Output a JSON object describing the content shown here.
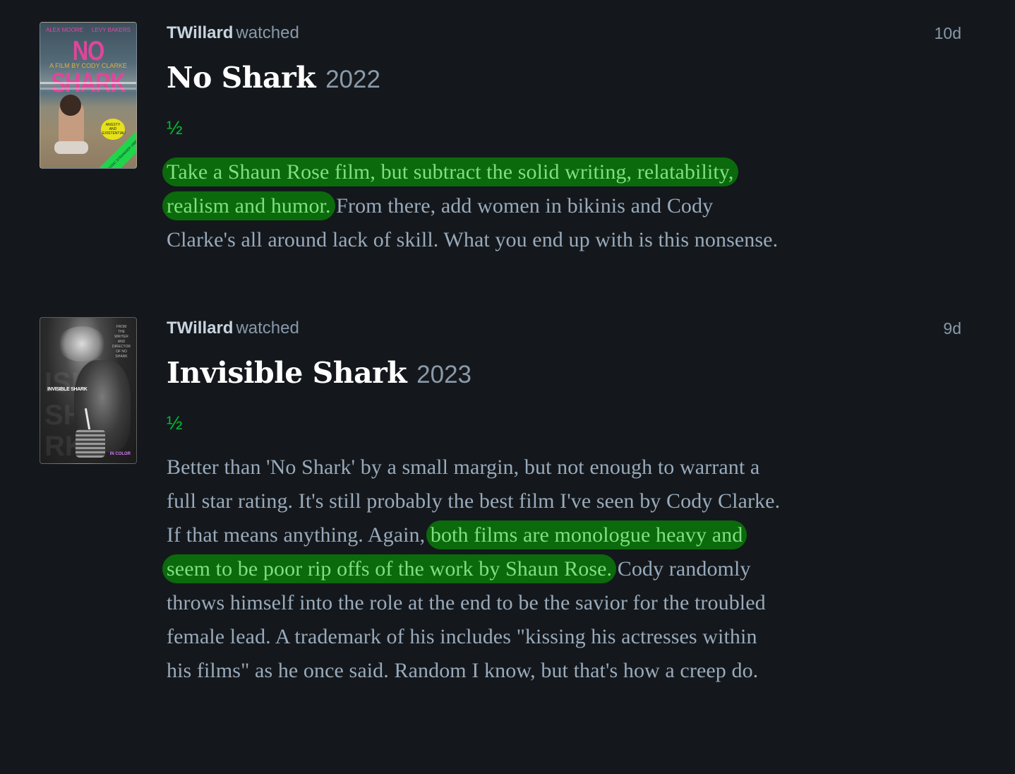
{
  "entries": [
    {
      "user": "TWillard",
      "action": "watched",
      "time_ago": "10d",
      "film_title": "No Shark",
      "film_year": "2022",
      "rating": "½",
      "poster": {
        "title": "NO SHARK",
        "subtitle": "A FILM BY CODY CLARKE",
        "top_left": "ALEX MOORE",
        "top_right": "LEVY BAKERS",
        "badge": "ANGSTY AND EXISTENTIAL!",
        "corner": "CLASSIC STRANGER VIBES"
      },
      "review": {
        "highlight": "Take a Shaun Rose film, but subtract the solid writing, relatability, realism and humor.",
        "rest": " From there, add women in bikinis and Cody Clarke's all around lack of skill. What you end up with is this nonsense."
      }
    },
    {
      "user": "TWillard",
      "action": "watched",
      "time_ago": "9d",
      "film_title": "Invisible Shark",
      "film_year": "2023",
      "rating": "½",
      "poster": {
        "title": "INVISIBLE SHARK",
        "credit": "FROM THE WRITER AND DIRECTOR OF NO SHARK",
        "ghost_1": "ISI",
        "ghost_2": "SH",
        "ghost_3": "RK",
        "corner": "IN COLOR"
      },
      "review": {
        "before": "Better than 'No Shark' by a small margin, but not enough to warrant a full star rating. It's still probably the best film I've seen by Cody Clarke. If that means anything. Again, ",
        "highlight": "both films are monologue heavy and seem to be poor rip offs of the work by Shaun Rose.",
        "after": " Cody randomly throws himself into the role at the end to be the savior for the troubled female lead. A trademark of his includes \"kissing his actresses within his films\" as he once said. Random I know, but that's how a creep do."
      }
    }
  ],
  "colors": {
    "background": "#14181c",
    "rating_green": "#00c030",
    "highlight_bg": "#0b6a0b",
    "highlight_text": "#7fe07f"
  }
}
